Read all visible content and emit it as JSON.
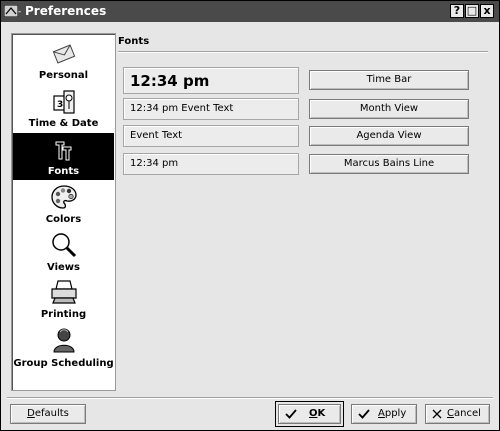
{
  "window": {
    "title": "Preferences",
    "buttons": {
      "help": "?",
      "maximize": "□",
      "close": "x"
    }
  },
  "sidebar": {
    "items": [
      {
        "label": "Personal",
        "icon": "envelope-icon",
        "selected": false
      },
      {
        "label": "Time & Date",
        "icon": "calendar-clock-icon",
        "selected": false
      },
      {
        "label": "Fonts",
        "icon": "fonts-icon",
        "selected": true
      },
      {
        "label": "Colors",
        "icon": "palette-icon",
        "selected": false
      },
      {
        "label": "Views",
        "icon": "magnifier-icon",
        "selected": false
      },
      {
        "label": "Printing",
        "icon": "printer-icon",
        "selected": false
      },
      {
        "label": "Group Scheduling",
        "icon": "person-icon",
        "selected": false
      }
    ]
  },
  "main": {
    "section_title": "Fonts",
    "font_rows": [
      {
        "preview": "12:34 pm",
        "button": "Time Bar"
      },
      {
        "preview": "12:34 pm Event Text",
        "button": "Month View"
      },
      {
        "preview": "Event Text",
        "button": "Agenda View"
      },
      {
        "preview": "12:34 pm",
        "button": "Marcus Bains Line"
      }
    ]
  },
  "footer": {
    "defaults": {
      "mnemonic": "D",
      "rest": "efaults"
    },
    "ok": {
      "mnemonic": "O",
      "rest": "K",
      "icon": "checkmark-icon"
    },
    "apply": {
      "mnemonic": "A",
      "rest": "pply",
      "icon": "checkmark-icon"
    },
    "cancel": {
      "mnemonic": "C",
      "rest": "ancel",
      "icon": "x-icon"
    }
  },
  "colors": {
    "titlebar": "#4a4a4a",
    "selection": "#000000",
    "panel": "#e6e6e6"
  }
}
